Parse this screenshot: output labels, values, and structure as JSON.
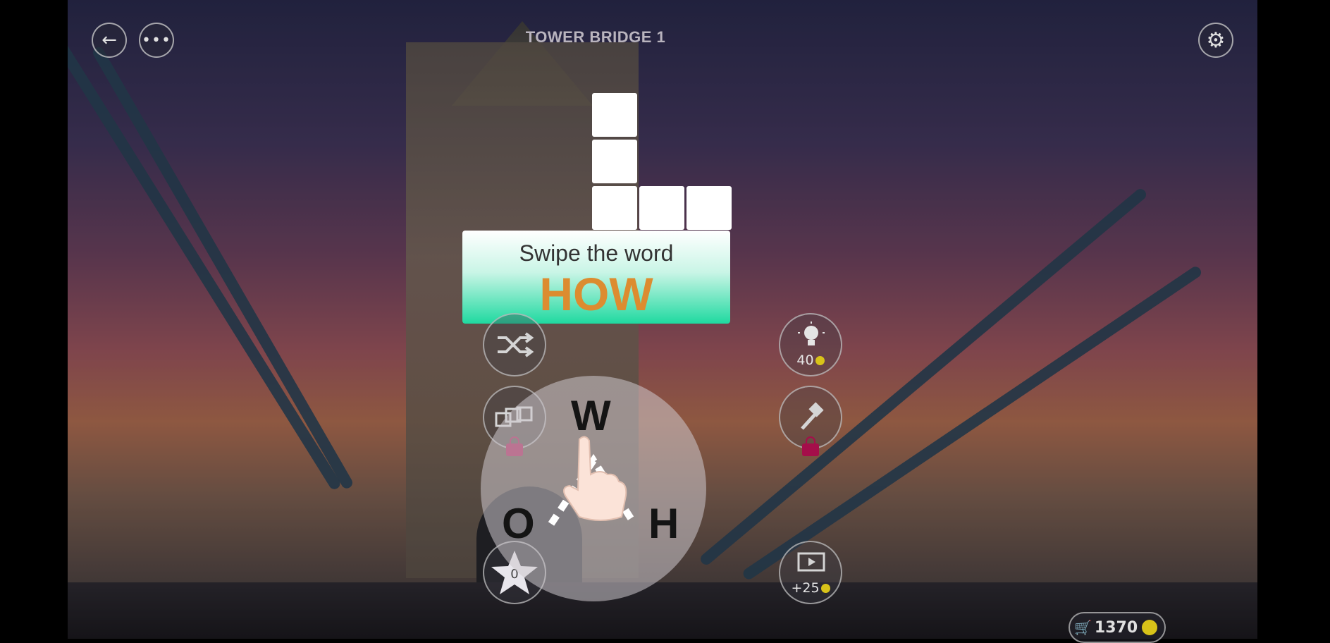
{
  "header": {
    "title": "TOWER BRIDGE 1",
    "back_icon": "arrow-left-icon",
    "menu_icon": "more-dots-icon",
    "settings_icon": "gear-icon"
  },
  "tutorial": {
    "line": "Swipe the word",
    "word": "HOW"
  },
  "buttons": {
    "hint_cost": "40",
    "video_reward": "+25",
    "stars": "0"
  },
  "wheel_letters": [
    "W",
    "O",
    "H"
  ],
  "coins": "1370",
  "colors": {
    "tip_word": "#dc8c30",
    "tip_gradient_end": "#1fd9a0",
    "lock": "#a50e4a",
    "coin": "#d8c319"
  }
}
